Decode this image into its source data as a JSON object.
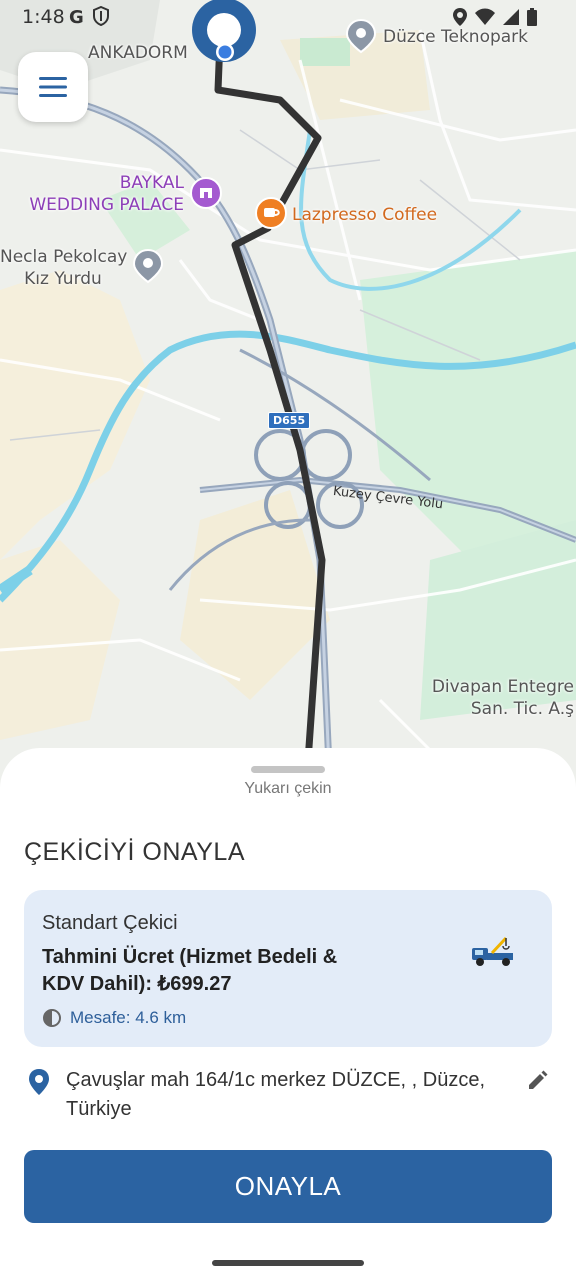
{
  "status_bar": {
    "time": "1:48"
  },
  "map": {
    "pois": {
      "ankadorm": "ANKADORM",
      "teknopark": "Düzce Teknopark",
      "baykal_line1": "BAYKAL",
      "baykal_line2": "WEDDING PALACE",
      "lazpresso": "Lazpresso Coffee",
      "necla_line1": "Necla Pekolcay",
      "necla_line2": "Kız Yurdu",
      "divapan_line1": "Divapan Entegre",
      "divapan_line2": "San. Tic. A.ş"
    },
    "road_shield": "D655",
    "road_name": "Kuzey Çevre Yolu"
  },
  "sheet": {
    "pull_hint": "Yukarı çekin",
    "title": "ÇEKİCİYİ ONAYLA",
    "card": {
      "service_type": "Standart Çekici",
      "price_text": "Tahmini Ücret (Hizmet Bedeli & KDV Dahil): ₺699.27",
      "distance_text": "Mesafe: 4.6 km"
    },
    "address": "Çavuşlar mah 164/1c merkez DÜZCE, , Düzce, Türkiye",
    "confirm_label": "ONAYLA"
  },
  "colors": {
    "primary": "#2b63a2",
    "route": "#333333",
    "card_bg": "#e3ecf8",
    "water": "#7dd0e8",
    "park": "#cfe9d4"
  }
}
